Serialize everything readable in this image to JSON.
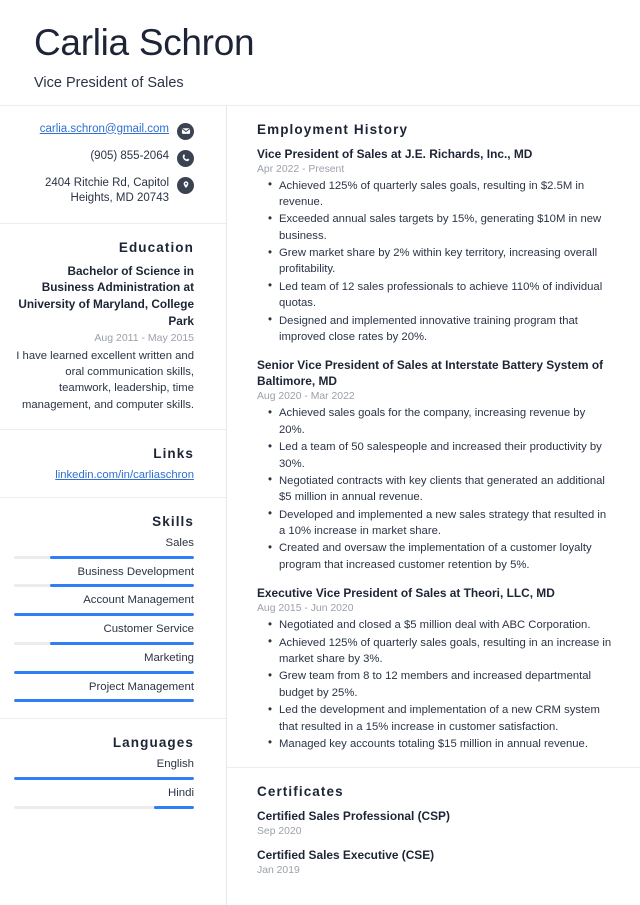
{
  "header": {
    "name": "Carlia Schron",
    "job_title": "Vice President of Sales"
  },
  "accent_color": "#2d7ef7",
  "contact": {
    "email": "carlia.schron@gmail.com",
    "email_icon": "envelope-icon",
    "phone": "(905) 855-2064",
    "phone_icon": "phone-icon",
    "address": "2404 Ritchie Rd, Capitol Heights, MD 20743",
    "address_icon": "location-pin-icon"
  },
  "education": {
    "heading": "Education",
    "degree": "Bachelor of Science in Business Administration at University of Maryland, College Park",
    "date": "Aug 2011 - May 2015",
    "description": "I have learned excellent written and oral communication skills, teamwork, leadership, time management, and computer skills."
  },
  "links": {
    "heading": "Links",
    "items": [
      {
        "label": "linkedin.com/in/carliaschron"
      }
    ]
  },
  "skills": {
    "heading": "Skills",
    "items": [
      {
        "label": "Sales",
        "level": 80
      },
      {
        "label": "Business Development",
        "level": 80
      },
      {
        "label": "Account Management",
        "level": 100
      },
      {
        "label": "Customer Service",
        "level": 80
      },
      {
        "label": "Marketing",
        "level": 100
      },
      {
        "label": "Project Management",
        "level": 100
      }
    ]
  },
  "languages": {
    "heading": "Languages",
    "items": [
      {
        "label": "English",
        "level": 100
      },
      {
        "label": "Hindi",
        "level": 22
      }
    ]
  },
  "employment": {
    "heading": "Employment History",
    "jobs": [
      {
        "role": "Vice President of Sales at J.E. Richards, Inc., MD",
        "date": "Apr 2022 - Present",
        "bullets": [
          "Achieved 125% of quarterly sales goals, resulting in $2.5M in revenue.",
          "Exceeded annual sales targets by 15%, generating $10M in new business.",
          "Grew market share by 2% within key territory, increasing overall profitability.",
          "Led team of 12 sales professionals to achieve 110% of individual quotas.",
          "Designed and implemented innovative training program that improved close rates by 20%."
        ]
      },
      {
        "role": "Senior Vice President of Sales at Interstate Battery System of Baltimore, MD",
        "date": "Aug 2020 - Mar 2022",
        "bullets": [
          "Achieved sales goals for the company, increasing revenue by 20%.",
          "Led a team of 50 salespeople and increased their productivity by 30%.",
          "Negotiated contracts with key clients that generated an additional $5 million in annual revenue.",
          "Developed and implemented a new sales strategy that resulted in a 10% increase in market share.",
          "Created and oversaw the implementation of a customer loyalty program that increased customer retention by 5%."
        ]
      },
      {
        "role": "Executive Vice President of Sales at Theori, LLC, MD",
        "date": "Aug 2015 - Jun 2020",
        "bullets": [
          "Negotiated and closed a $5 million deal with ABC Corporation.",
          "Achieved 125% of quarterly sales goals, resulting in an increase in market share by 3%.",
          "Grew team from 8 to 12 members and increased departmental budget by 25%.",
          "Led the development and implementation of a new CRM system that resulted in a 15% increase in customer satisfaction.",
          "Managed key accounts totaling $15 million in annual revenue."
        ]
      }
    ]
  },
  "certificates": {
    "heading": "Certificates",
    "items": [
      {
        "name": "Certified Sales Professional (CSP)",
        "date": "Sep 2020"
      },
      {
        "name": "Certified Sales Executive (CSE)",
        "date": "Jan 2019"
      }
    ]
  }
}
